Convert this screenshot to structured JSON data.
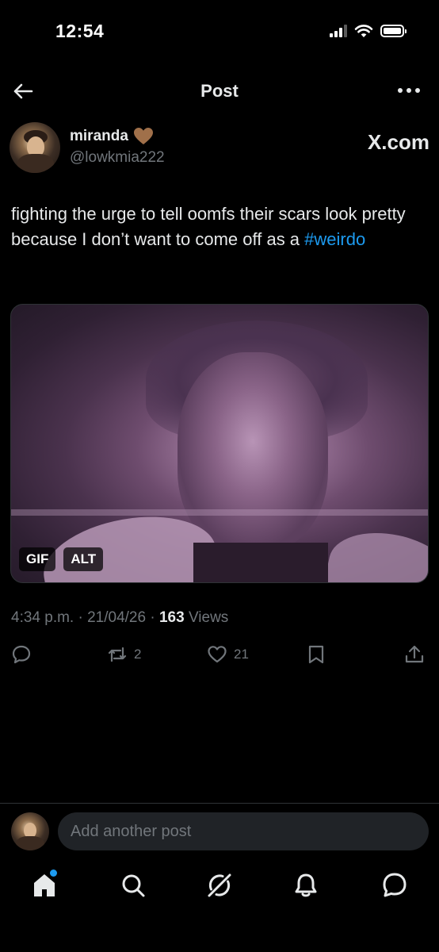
{
  "status_bar": {
    "time": "12:54"
  },
  "header": {
    "title": "Post"
  },
  "author": {
    "display_name": "miranda",
    "handle": "@lowkmia222",
    "source_label": "X.com"
  },
  "post": {
    "text": "fighting the urge to tell oomfs their scars look pretty because I don’t want to come off as a ",
    "hashtag": "#weirdo",
    "media_badges": {
      "gif": "GIF",
      "alt": "ALT"
    },
    "meta": {
      "time": "4:34 p.m.",
      "date": "21/04/26",
      "separator": " · ",
      "views_count": "163",
      "views_label": "Views"
    },
    "actions": {
      "reposts": "2",
      "likes": "21"
    }
  },
  "composer": {
    "placeholder": "Add another post"
  },
  "colors": {
    "accent": "#1d9bf0",
    "background": "#000000",
    "muted": "#71767b",
    "text": "#e7e9ea"
  },
  "icons": {
    "nav": [
      "back-arrow-icon",
      "more-dots-icon"
    ],
    "actions": [
      "reply-icon",
      "repost-icon",
      "like-icon",
      "bookmark-icon",
      "share-icon"
    ],
    "tabs": [
      "home-icon",
      "search-icon",
      "grok-icon",
      "notifications-icon",
      "messages-icon"
    ]
  }
}
